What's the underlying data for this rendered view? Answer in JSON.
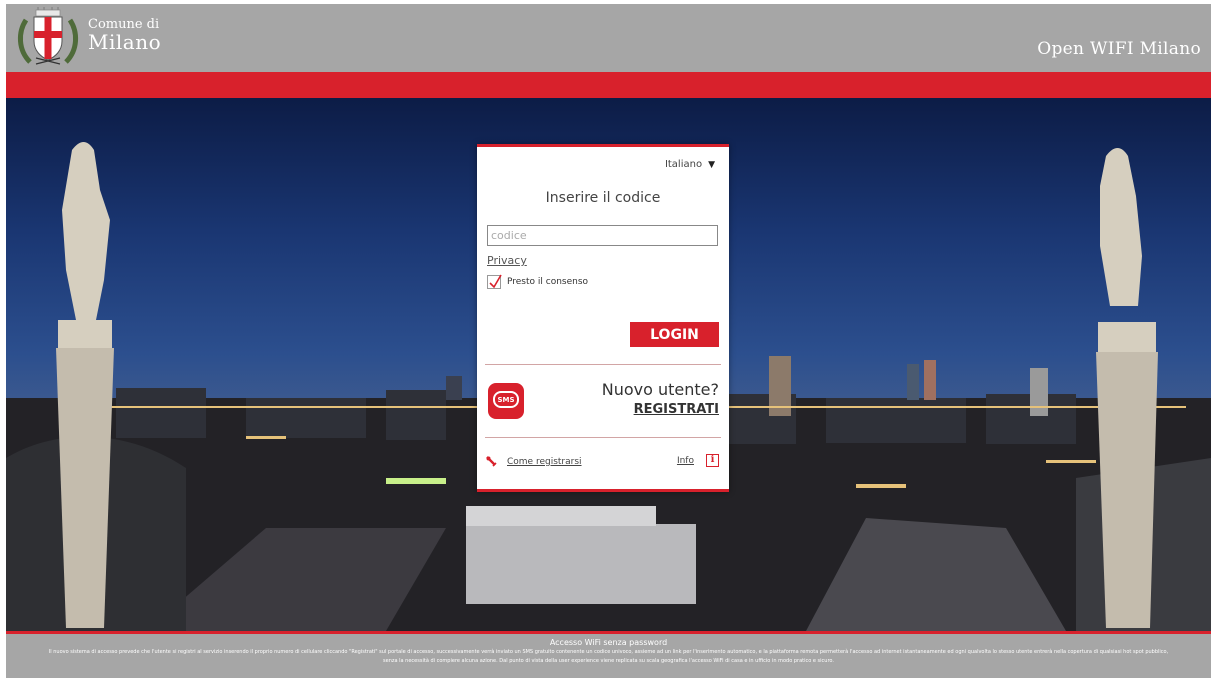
{
  "header": {
    "logo_line1": "Comune di",
    "logo_line2": "Milano",
    "site_title": "Open WIFI Milano"
  },
  "login_card": {
    "language": "Italiano",
    "title": "Inserire il codice",
    "code_placeholder": "codice",
    "code_value": "",
    "privacy_link": "Privacy",
    "consent_checked": true,
    "consent_label": "Presto il consenso",
    "login_button": "LOGIN",
    "sms_icon_text": "SMS",
    "new_user_label": "Nuovo utente?",
    "register_link": "REGISTRATI",
    "how_to_register": "Come registrarsi",
    "info_label": "Info",
    "info_icon_text": "i"
  },
  "footer": {
    "title": "Accesso WiFi senza password",
    "body": "Il nuovo sistema di accesso prevede che l'utente si registri al servizio inserendo il proprio numero di cellulare cliccando \"Registrati\" sul portale di accesso, successivamente verrà inviato un SMS gratuito contenente un codice univoco, assieme ad un link per l'inserimento automatico, e la piattaforma remota permetterà l'accesso ad internet istantaneamente ed ogni qualvolta lo stesso utente entrerà nella copertura di qualsiasi hot spot pubblico, senza la necessità di compiere alcuna azione. Dal punto di vista della user experience viene replicata su scala geografica l'accesso WiFi di casa e in ufficio in modo pratico e sicuro."
  },
  "colors": {
    "brand_red": "#d8212c",
    "header_gray": "#a6a6a6"
  },
  "icons": [
    "milano-coat-of-arms-logo",
    "caret-down-icon",
    "checkmark-icon",
    "sms-icon",
    "wrench-icon",
    "info-icon"
  ]
}
